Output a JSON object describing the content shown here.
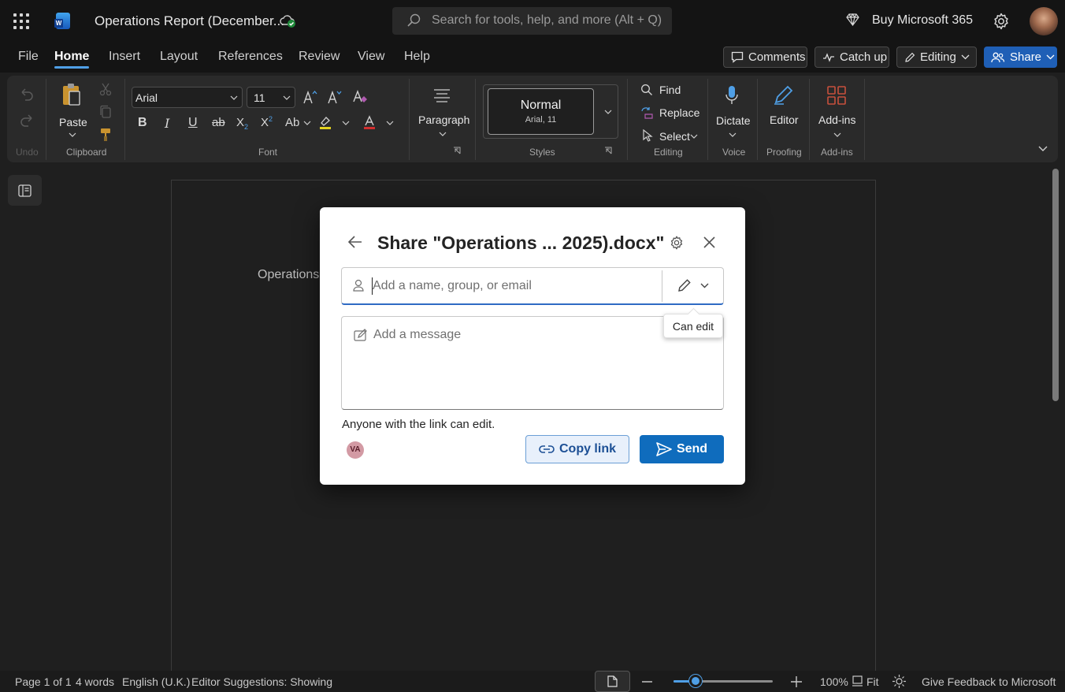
{
  "app": {
    "doc_title": "Operations Report (December...",
    "search_placeholder": "Search for tools, help, and more (Alt + Q)",
    "buy_label": "Buy Microsoft 365"
  },
  "menu": {
    "items": [
      "File",
      "Home",
      "Insert",
      "Layout",
      "References",
      "Review",
      "View",
      "Help"
    ],
    "active": "Home"
  },
  "header_buttons": {
    "comments": "Comments",
    "catchup": "Catch up",
    "editing": "Editing",
    "share": "Share"
  },
  "ribbon": {
    "undo_group": "Undo",
    "clipboard": {
      "paste": "Paste",
      "group": "Clipboard"
    },
    "font": {
      "name": "Arial",
      "size": "11",
      "group": "Font"
    },
    "paragraph": {
      "label": "Paragraph"
    },
    "styles": {
      "style_name": "Normal",
      "style_desc": "Arial, 11",
      "group": "Styles"
    },
    "editing": {
      "find": "Find",
      "replace": "Replace",
      "select": "Select",
      "group": "Editing"
    },
    "voice": {
      "dictate": "Dictate",
      "group": "Voice"
    },
    "proofing": {
      "editor": "Editor",
      "group": "Proofing"
    },
    "addins": {
      "label": "Add-ins",
      "group": "Add-ins"
    }
  },
  "document": {
    "visible_text": "Operations"
  },
  "share_dialog": {
    "title": "Share \"Operations ... 2025).docx\"",
    "name_placeholder": "Add a name, group, or email",
    "message_placeholder": "Add a message",
    "permission_tooltip": "Can edit",
    "link_setting": "Anyone with the link can edit.",
    "avatar_initials": "VA",
    "copy_link": "Copy link",
    "send": "Send"
  },
  "statusbar": {
    "page": "Page 1 of 1",
    "words": "4 words",
    "language": "English (U.K.)",
    "suggestions": "Editor Suggestions: Showing",
    "zoom": "100%",
    "zoom_fraction": 0.22,
    "fit": "Fit",
    "feedback": "Give Feedback to Microsoft"
  },
  "colors": {
    "accent": "#0f6cbd",
    "share_button": "#1f5fb6",
    "background": "#1f1f1f"
  }
}
